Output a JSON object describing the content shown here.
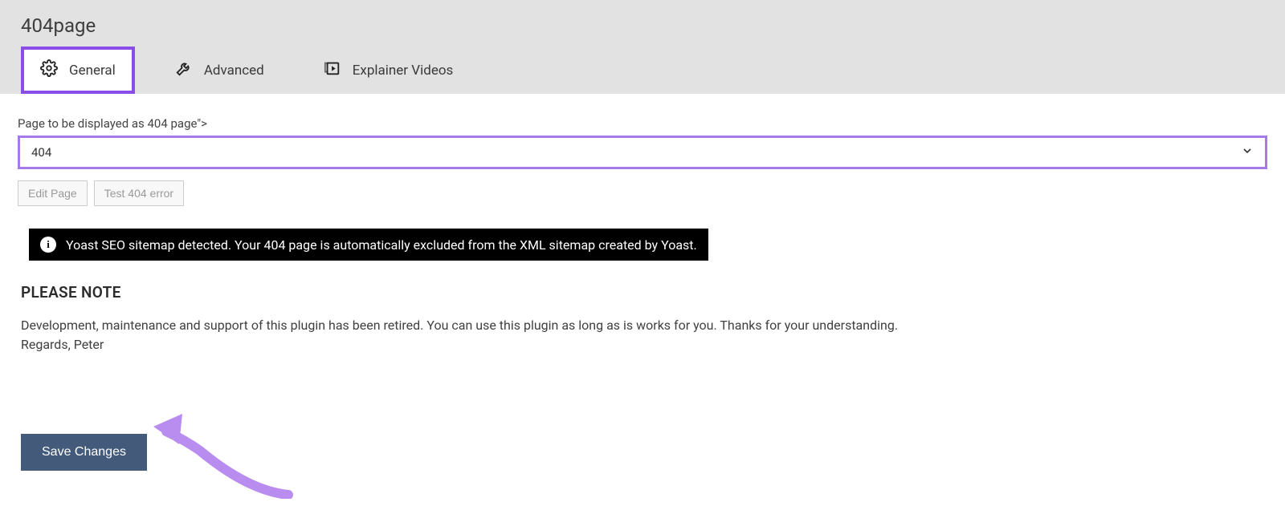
{
  "header": {
    "title": "404page",
    "tabs": [
      {
        "label": "General",
        "icon": "gear-icon",
        "active": true
      },
      {
        "label": "Advanced",
        "icon": "wrench-icon",
        "active": false
      },
      {
        "label": "Explainer Videos",
        "icon": "video-icon",
        "active": false
      }
    ]
  },
  "general": {
    "field_label": "Page to be displayed as 404 page\">",
    "selected_page": "404",
    "edit_page_label": "Edit Page",
    "test_404_label": "Test 404 error"
  },
  "notice": {
    "text": "Yoast SEO sitemap detected. Your 404 page is automatically excluded from the XML sitemap created by Yoast."
  },
  "note": {
    "heading": "PLEASE NOTE",
    "body_line1": "Development, maintenance and support of this plugin has been retired. You can use this plugin as long as is works for you. Thanks for your understanding.",
    "body_line2": "Regards, Peter"
  },
  "actions": {
    "save_label": "Save Changes"
  },
  "colors": {
    "highlight": "#8a4de8",
    "arrow": "#b98df0",
    "primary_button": "#445a7a"
  }
}
